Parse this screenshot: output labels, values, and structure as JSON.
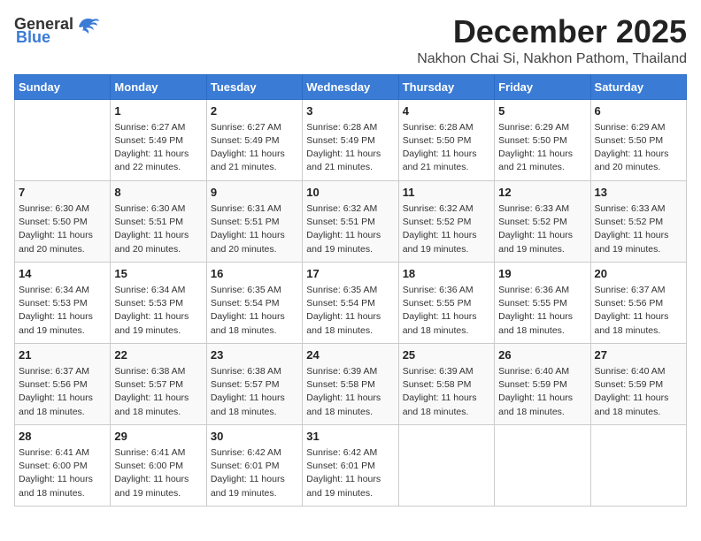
{
  "logo": {
    "general": "General",
    "blue": "Blue"
  },
  "title": "December 2025",
  "subtitle": "Nakhon Chai Si, Nakhon Pathom, Thailand",
  "weekdays": [
    "Sunday",
    "Monday",
    "Tuesday",
    "Wednesday",
    "Thursday",
    "Friday",
    "Saturday"
  ],
  "weeks": [
    [
      {
        "day": "",
        "info": ""
      },
      {
        "day": "1",
        "info": "Sunrise: 6:27 AM\nSunset: 5:49 PM\nDaylight: 11 hours and 22 minutes."
      },
      {
        "day": "2",
        "info": "Sunrise: 6:27 AM\nSunset: 5:49 PM\nDaylight: 11 hours and 21 minutes."
      },
      {
        "day": "3",
        "info": "Sunrise: 6:28 AM\nSunset: 5:49 PM\nDaylight: 11 hours and 21 minutes."
      },
      {
        "day": "4",
        "info": "Sunrise: 6:28 AM\nSunset: 5:50 PM\nDaylight: 11 hours and 21 minutes."
      },
      {
        "day": "5",
        "info": "Sunrise: 6:29 AM\nSunset: 5:50 PM\nDaylight: 11 hours and 21 minutes."
      },
      {
        "day": "6",
        "info": "Sunrise: 6:29 AM\nSunset: 5:50 PM\nDaylight: 11 hours and 20 minutes."
      }
    ],
    [
      {
        "day": "7",
        "info": "Sunrise: 6:30 AM\nSunset: 5:50 PM\nDaylight: 11 hours and 20 minutes."
      },
      {
        "day": "8",
        "info": "Sunrise: 6:30 AM\nSunset: 5:51 PM\nDaylight: 11 hours and 20 minutes."
      },
      {
        "day": "9",
        "info": "Sunrise: 6:31 AM\nSunset: 5:51 PM\nDaylight: 11 hours and 20 minutes."
      },
      {
        "day": "10",
        "info": "Sunrise: 6:32 AM\nSunset: 5:51 PM\nDaylight: 11 hours and 19 minutes."
      },
      {
        "day": "11",
        "info": "Sunrise: 6:32 AM\nSunset: 5:52 PM\nDaylight: 11 hours and 19 minutes."
      },
      {
        "day": "12",
        "info": "Sunrise: 6:33 AM\nSunset: 5:52 PM\nDaylight: 11 hours and 19 minutes."
      },
      {
        "day": "13",
        "info": "Sunrise: 6:33 AM\nSunset: 5:52 PM\nDaylight: 11 hours and 19 minutes."
      }
    ],
    [
      {
        "day": "14",
        "info": "Sunrise: 6:34 AM\nSunset: 5:53 PM\nDaylight: 11 hours and 19 minutes."
      },
      {
        "day": "15",
        "info": "Sunrise: 6:34 AM\nSunset: 5:53 PM\nDaylight: 11 hours and 19 minutes."
      },
      {
        "day": "16",
        "info": "Sunrise: 6:35 AM\nSunset: 5:54 PM\nDaylight: 11 hours and 18 minutes."
      },
      {
        "day": "17",
        "info": "Sunrise: 6:35 AM\nSunset: 5:54 PM\nDaylight: 11 hours and 18 minutes."
      },
      {
        "day": "18",
        "info": "Sunrise: 6:36 AM\nSunset: 5:55 PM\nDaylight: 11 hours and 18 minutes."
      },
      {
        "day": "19",
        "info": "Sunrise: 6:36 AM\nSunset: 5:55 PM\nDaylight: 11 hours and 18 minutes."
      },
      {
        "day": "20",
        "info": "Sunrise: 6:37 AM\nSunset: 5:56 PM\nDaylight: 11 hours and 18 minutes."
      }
    ],
    [
      {
        "day": "21",
        "info": "Sunrise: 6:37 AM\nSunset: 5:56 PM\nDaylight: 11 hours and 18 minutes."
      },
      {
        "day": "22",
        "info": "Sunrise: 6:38 AM\nSunset: 5:57 PM\nDaylight: 11 hours and 18 minutes."
      },
      {
        "day": "23",
        "info": "Sunrise: 6:38 AM\nSunset: 5:57 PM\nDaylight: 11 hours and 18 minutes."
      },
      {
        "day": "24",
        "info": "Sunrise: 6:39 AM\nSunset: 5:58 PM\nDaylight: 11 hours and 18 minutes."
      },
      {
        "day": "25",
        "info": "Sunrise: 6:39 AM\nSunset: 5:58 PM\nDaylight: 11 hours and 18 minutes."
      },
      {
        "day": "26",
        "info": "Sunrise: 6:40 AM\nSunset: 5:59 PM\nDaylight: 11 hours and 18 minutes."
      },
      {
        "day": "27",
        "info": "Sunrise: 6:40 AM\nSunset: 5:59 PM\nDaylight: 11 hours and 18 minutes."
      }
    ],
    [
      {
        "day": "28",
        "info": "Sunrise: 6:41 AM\nSunset: 6:00 PM\nDaylight: 11 hours and 18 minutes."
      },
      {
        "day": "29",
        "info": "Sunrise: 6:41 AM\nSunset: 6:00 PM\nDaylight: 11 hours and 19 minutes."
      },
      {
        "day": "30",
        "info": "Sunrise: 6:42 AM\nSunset: 6:01 PM\nDaylight: 11 hours and 19 minutes."
      },
      {
        "day": "31",
        "info": "Sunrise: 6:42 AM\nSunset: 6:01 PM\nDaylight: 11 hours and 19 minutes."
      },
      {
        "day": "",
        "info": ""
      },
      {
        "day": "",
        "info": ""
      },
      {
        "day": "",
        "info": ""
      }
    ]
  ]
}
